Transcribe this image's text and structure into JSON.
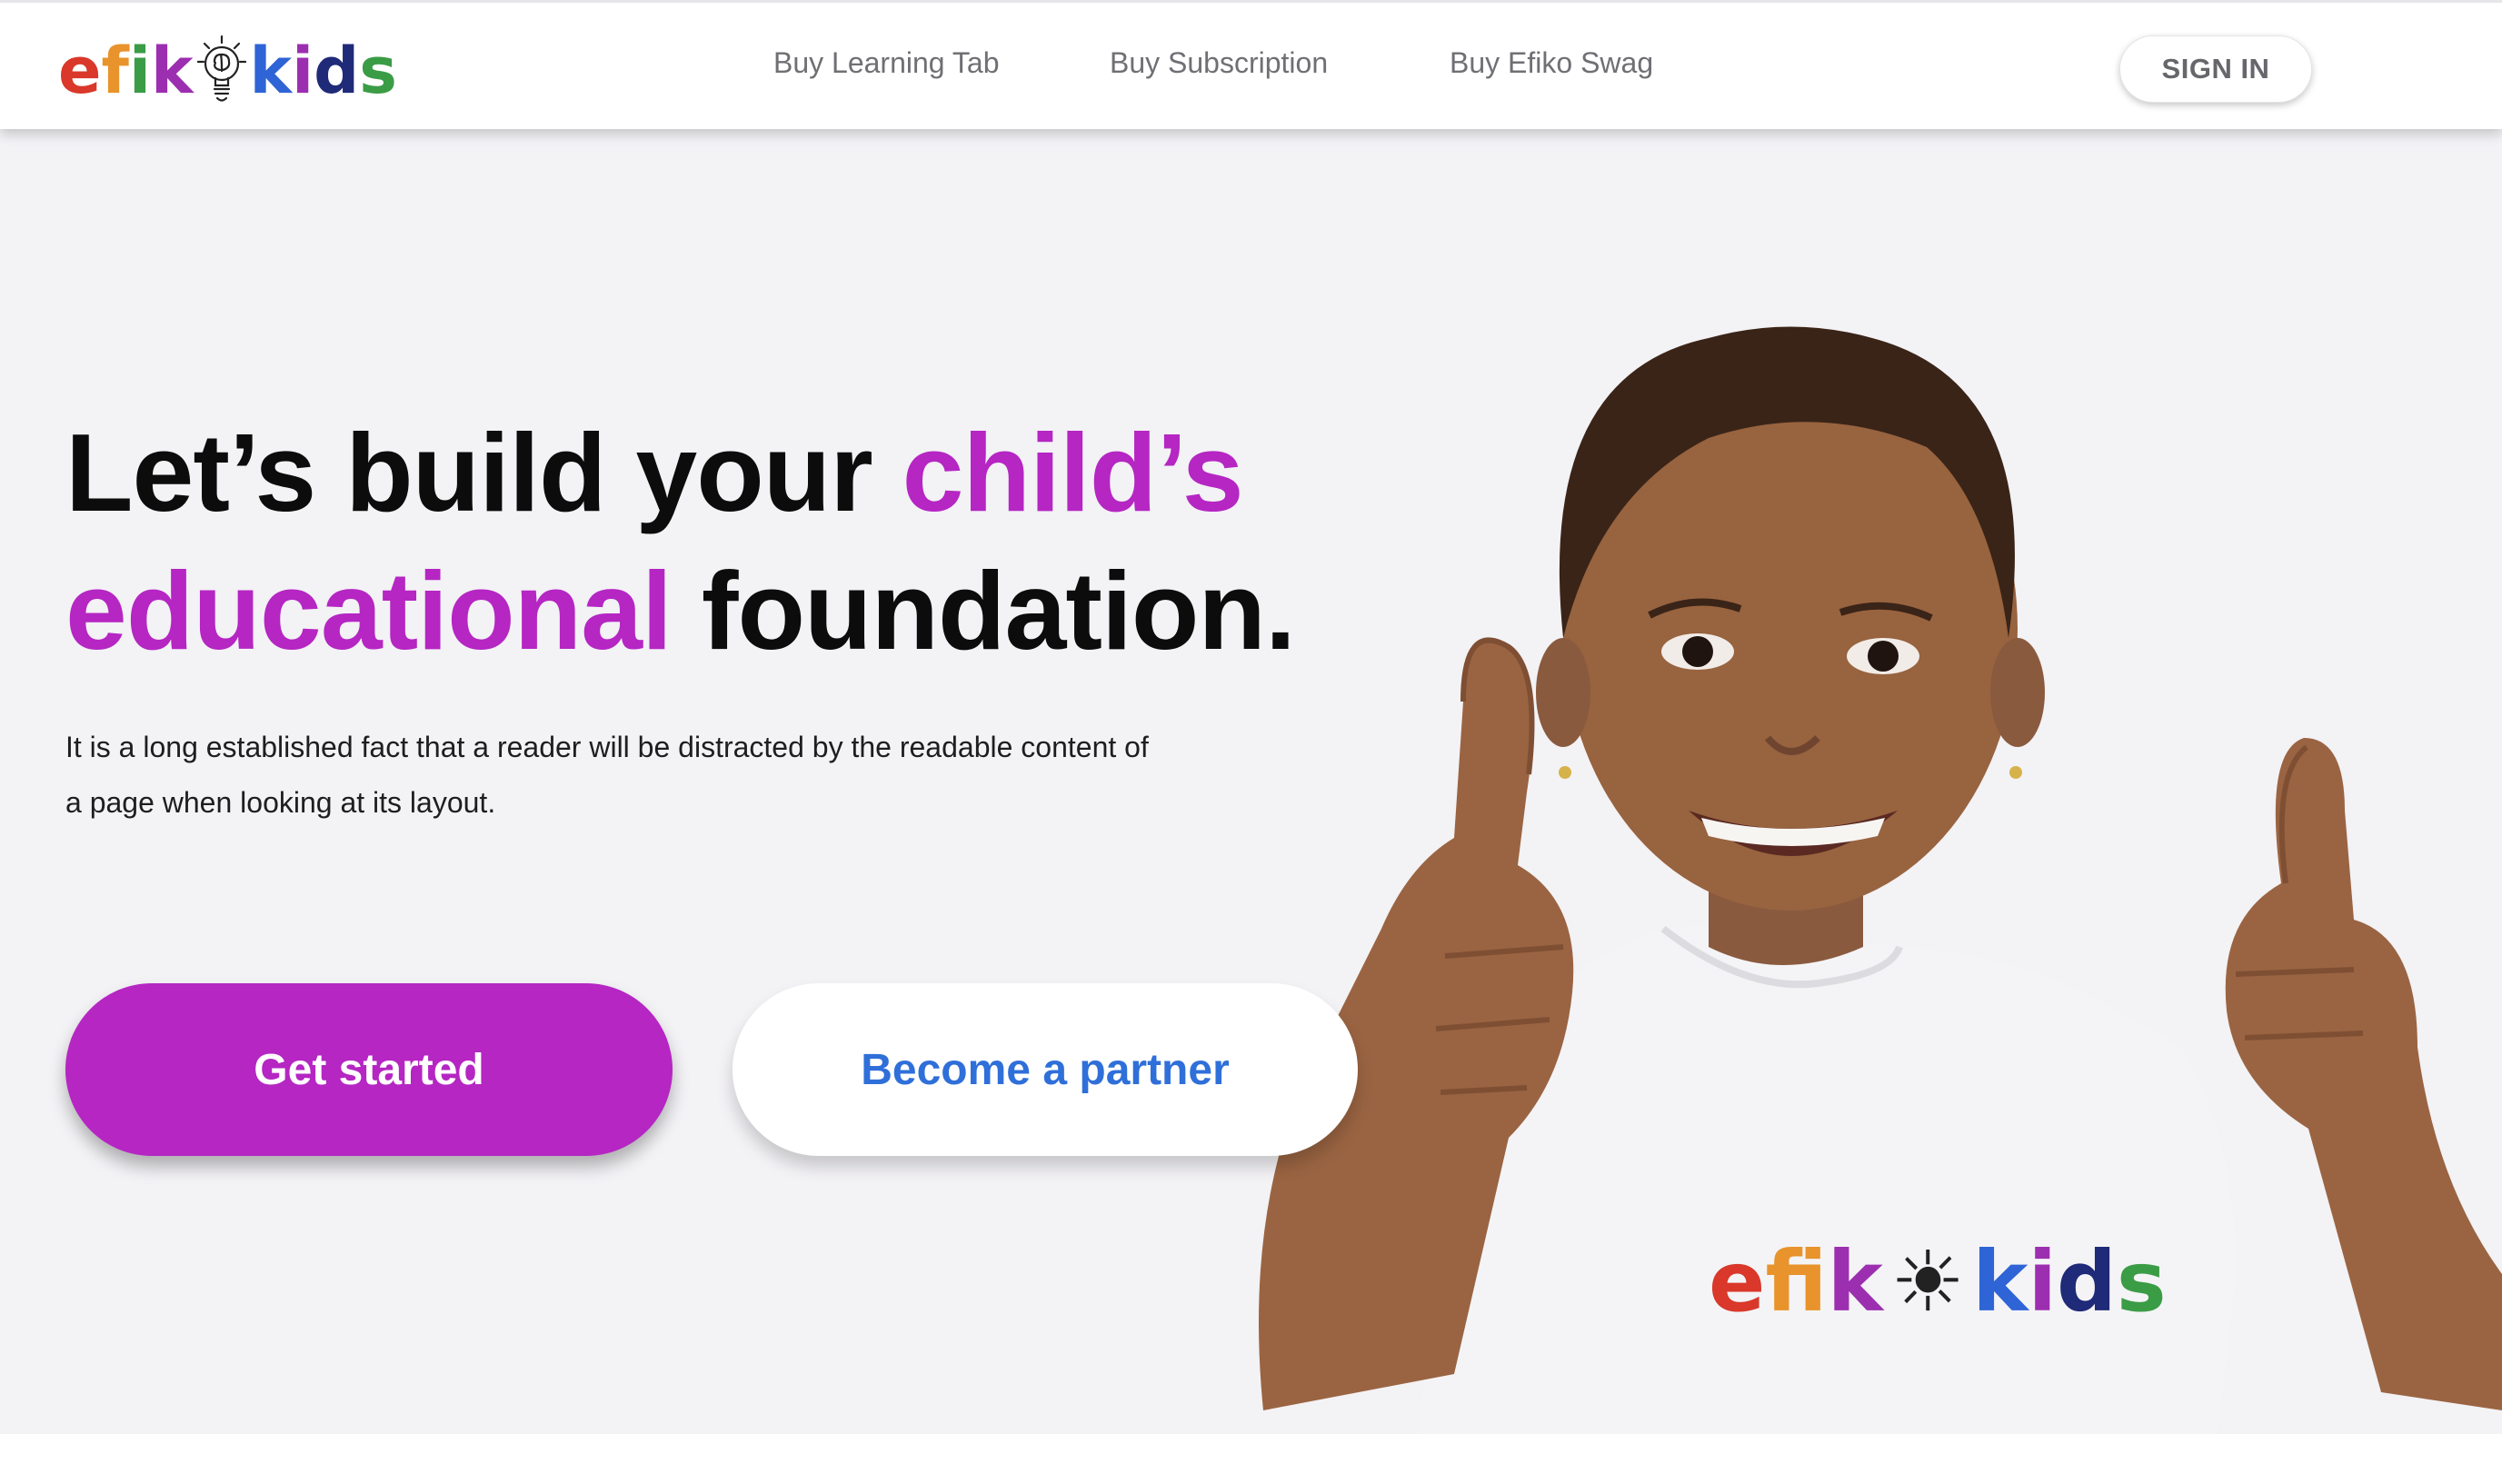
{
  "header": {
    "logo": {
      "letters": [
        {
          "char": "e",
          "color": "#d9382a"
        },
        {
          "char": "f",
          "color": "#e8932b"
        },
        {
          "char": "i",
          "color": "#3b9c46"
        },
        {
          "char": "k",
          "color": "#9c2fb0"
        },
        {
          "char": "k",
          "color": "#2f64d6"
        },
        {
          "char": "i",
          "color": "#9c2fb0"
        },
        {
          "char": "d",
          "color": "#1f2a78"
        },
        {
          "char": "s",
          "color": "#3b9c46"
        }
      ],
      "icon": "lightbulb-brain-icon"
    },
    "nav": [
      "Buy Learning Tab",
      "Buy Subscription",
      "Buy Efiko Swag"
    ],
    "sign_in": "SIGN IN"
  },
  "hero": {
    "headline": {
      "part1": "Let’s build your ",
      "accent1": "child’s",
      "accent2": "educational",
      "part2": " foundation."
    },
    "description": "It is a long established fact that a reader will be distracted by the readable content of a page when looking at its layout.",
    "primary_button": "Get started",
    "secondary_button": "Become a partner",
    "shirt_logo": "efikokids"
  },
  "colors": {
    "accent": "#b526c3",
    "link_blue": "#2f6fd9",
    "hero_bg": "#f3f2f5"
  }
}
